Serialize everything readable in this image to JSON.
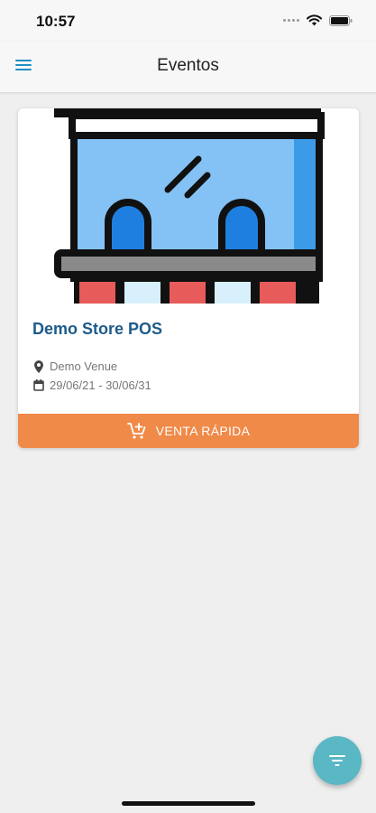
{
  "status_bar": {
    "time": "10:57"
  },
  "app_bar": {
    "title": "Eventos",
    "menu_icon": "menu-icon"
  },
  "event_card": {
    "title": "Demo Store POS",
    "venue": "Demo Venue",
    "dates": "29/06/21 - 30/06/31",
    "cta_label": "VENTA RÁPIDA",
    "image_icon": "storefront-illustration"
  },
  "fab": {
    "icon": "filter-icon"
  },
  "colors": {
    "accent": "#f08a48",
    "title": "#1d5b8a",
    "fab": "#5ab7c4",
    "menu": "#1f8fc4",
    "background": "#efefef"
  }
}
